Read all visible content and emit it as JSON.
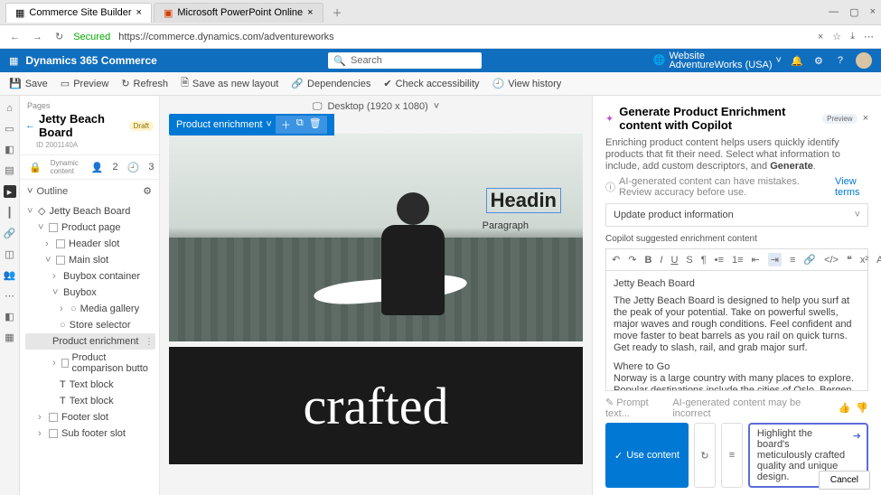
{
  "browser": {
    "tabs": [
      {
        "title": "Commerce Site Builder"
      },
      {
        "title": "Microsoft PowerPoint Online"
      }
    ],
    "secured_label": "Secured",
    "url": "https://commerce.dynamics.com/adventureworks"
  },
  "header": {
    "brand": "Dynamics 365 Commerce",
    "search_placeholder": "Search",
    "website_label": "Website",
    "website_name": "AdventureWorks (USA)"
  },
  "toolbar": {
    "save": "Save",
    "preview": "Preview",
    "refresh": "Refresh",
    "save_as": "Save as new layout",
    "dependencies": "Dependencies",
    "accessibility": "Check accessibility",
    "history": "View history"
  },
  "page": {
    "crumb": "Pages",
    "title": "Jetty Beach Board",
    "status": "Draft",
    "id": "ID 2001140A",
    "dynamic_label": "Dynamic content",
    "dyn1": "2",
    "dyn2": "3",
    "outline_label": "Outline"
  },
  "tree": {
    "root": "Jetty Beach Board",
    "product_page": "Product page",
    "header_slot": "Header slot",
    "main_slot": "Main slot",
    "buybox_container": "Buybox container",
    "buybox": "Buybox",
    "media_gallery": "Media gallery",
    "store_selector": "Store selector",
    "product_enrichment": "Product enrichment",
    "product_comparison": "Product comparison butto",
    "text_block": "Text block",
    "footer_slot": "Footer slot",
    "sub_footer_slot": "Sub footer slot"
  },
  "canvas": {
    "pill": "Product enrichment",
    "viewport_label": "Desktop (1920 x 1080)",
    "heading_placeholder": "Headin",
    "paragraph_placeholder": "Paragraph",
    "crafted": "crafted"
  },
  "copilot": {
    "title": "Generate Product Enrichment content with Copilot",
    "preview": "Preview",
    "desc_pre": "Enriching product content helps users quickly identify products that fit their need. Select what information to include, add custom descriptors, and ",
    "desc_bold": "Generate",
    "warn": "AI-generated content can have mistakes. Review accuracy before use.",
    "warn_link": "View terms",
    "dropdown": "Update product information",
    "suggested_label": "Copilot suggested enrichment content",
    "product_name": "Jetty Beach Board",
    "body1": "The Jetty Beach Board is designed to help you surf at the peak of your potential. Take on powerful swells, major waves and rough conditions. Feel confident and move faster to beat barrels as you rail on quick turns. Get ready to slash, rail, and grab major surf.",
    "body2_title": "Where to Go",
    "body2": "Norway is a large country with many places to explore. Popular destinations include the cities of Oslo, Bergen, and Trondheim, as well as the stunning fjords of the west coast. There are also many national parks and other outdoor attractions, such as the Arctic Circle, the Northern Lights, and the midnight sun.",
    "prompt_label": "Prompt text...",
    "feedback_label": "AI-generated content may be incorrect",
    "use_content": "Use content",
    "prompt_value": "Highlight the board's meticulously crafted quality and unique design.",
    "cancel": "Cancel"
  }
}
